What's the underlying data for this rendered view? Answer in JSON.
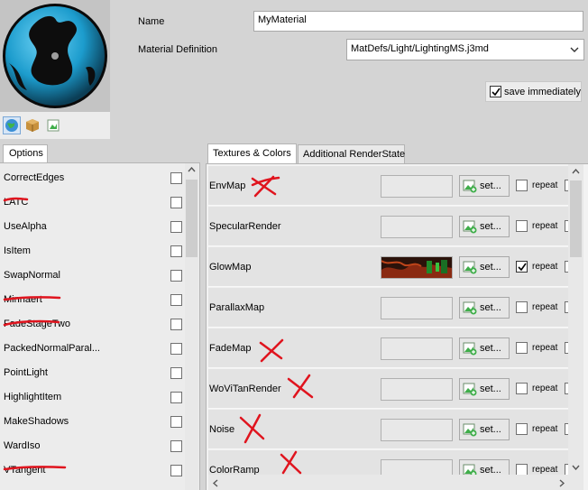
{
  "header": {
    "name_label": "Name",
    "name_value": "MyMaterial",
    "definition_label": "Material Definition",
    "definition_value": "MatDefs/Light/LightingMS.j3md",
    "save_label": "save immediately",
    "save_checked": true
  },
  "preview": {
    "tools": [
      "sphere-preview-icon",
      "box-preview-icon",
      "quad-preview-icon"
    ]
  },
  "options": {
    "tab_label": "Options",
    "items": [
      {
        "label": "CorrectEdges"
      },
      {
        "label": "LATC"
      },
      {
        "label": "UseAlpha"
      },
      {
        "label": "IsItem"
      },
      {
        "label": "SwapNormal"
      },
      {
        "label": "Minnaert"
      },
      {
        "label": "FadeStageTwo"
      },
      {
        "label": "PackedNormalParal..."
      },
      {
        "label": "PointLight"
      },
      {
        "label": "HighlightItem"
      },
      {
        "label": "MakeShadows"
      },
      {
        "label": "WardIso"
      },
      {
        "label": "VTangent"
      }
    ]
  },
  "textures": {
    "tabs": [
      "Textures & Colors",
      "Additional RenderState"
    ],
    "set_label": "set...",
    "repeat_label": "repeat",
    "items": [
      {
        "name": "EnvMap",
        "repeat": false
      },
      {
        "name": "SpecularRender",
        "repeat": false
      },
      {
        "name": "GlowMap",
        "repeat": true
      },
      {
        "name": "ParallaxMap",
        "repeat": false
      },
      {
        "name": "FadeMap",
        "repeat": false
      },
      {
        "name": "WoViTanRender",
        "repeat": false
      },
      {
        "name": "Noise",
        "repeat": false
      },
      {
        "name": "ColorRamp",
        "repeat": false
      }
    ]
  },
  "colors": {
    "annotation_red": "#e0141e",
    "preview_sphere": "#2aa6d6"
  }
}
